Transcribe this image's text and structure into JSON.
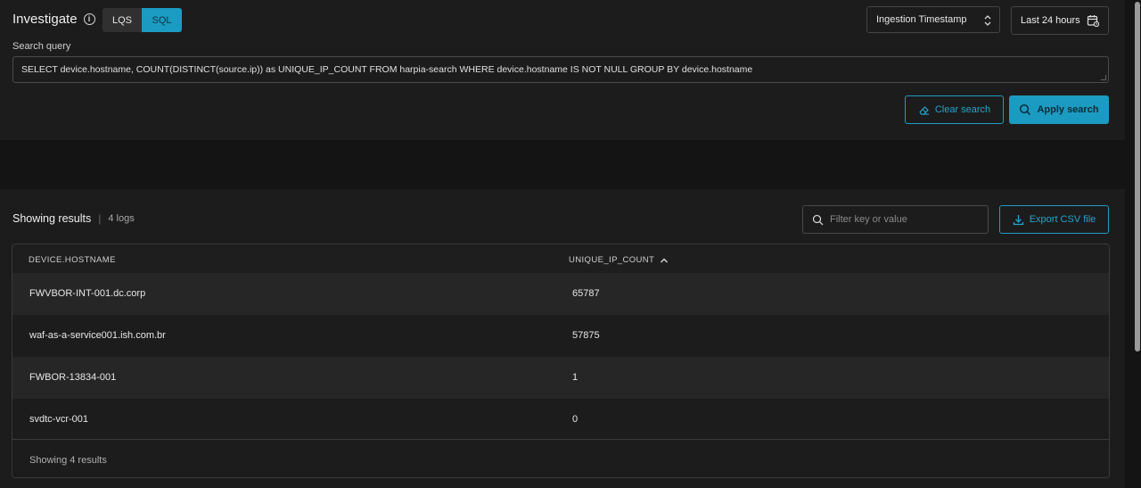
{
  "header": {
    "title": "Investigate",
    "info_icon": "info-icon",
    "modes": [
      {
        "label": "LQS",
        "active": false
      },
      {
        "label": "SQL",
        "active": true
      }
    ],
    "timestamp_field": "Ingestion Timestamp",
    "time_range": "Last 24 hours"
  },
  "search": {
    "label": "Search query",
    "query": "SELECT device.hostname, COUNT(DISTINCT(source.ip)) as UNIQUE_IP_COUNT FROM harpia-search WHERE device.hostname IS NOT NULL GROUP BY device.hostname",
    "clear_label": "Clear search",
    "apply_label": "Apply search"
  },
  "results": {
    "title": "Showing results",
    "count_label": "4 logs",
    "filter_placeholder": "Filter key or value",
    "export_label": "Export CSV file",
    "columns": {
      "hostname": "DEVICE.HOSTNAME",
      "count": "UNIQUE_IP_COUNT"
    },
    "sort_direction": "ascending",
    "rows": [
      {
        "hostname": "FWVBOR-INT-001.dc.corp",
        "count": "65787"
      },
      {
        "hostname": "waf-as-a-service001.ish.com.br",
        "count": "57875"
      },
      {
        "hostname": "FWBOR-13834-001",
        "count": "1"
      },
      {
        "hostname": "svdtc-vcr-001",
        "count": "0"
      }
    ],
    "footer": "Showing 4 results"
  },
  "colors": {
    "accent": "#1c9bc2",
    "background": "#141414",
    "panel": "#1c1c1c"
  }
}
